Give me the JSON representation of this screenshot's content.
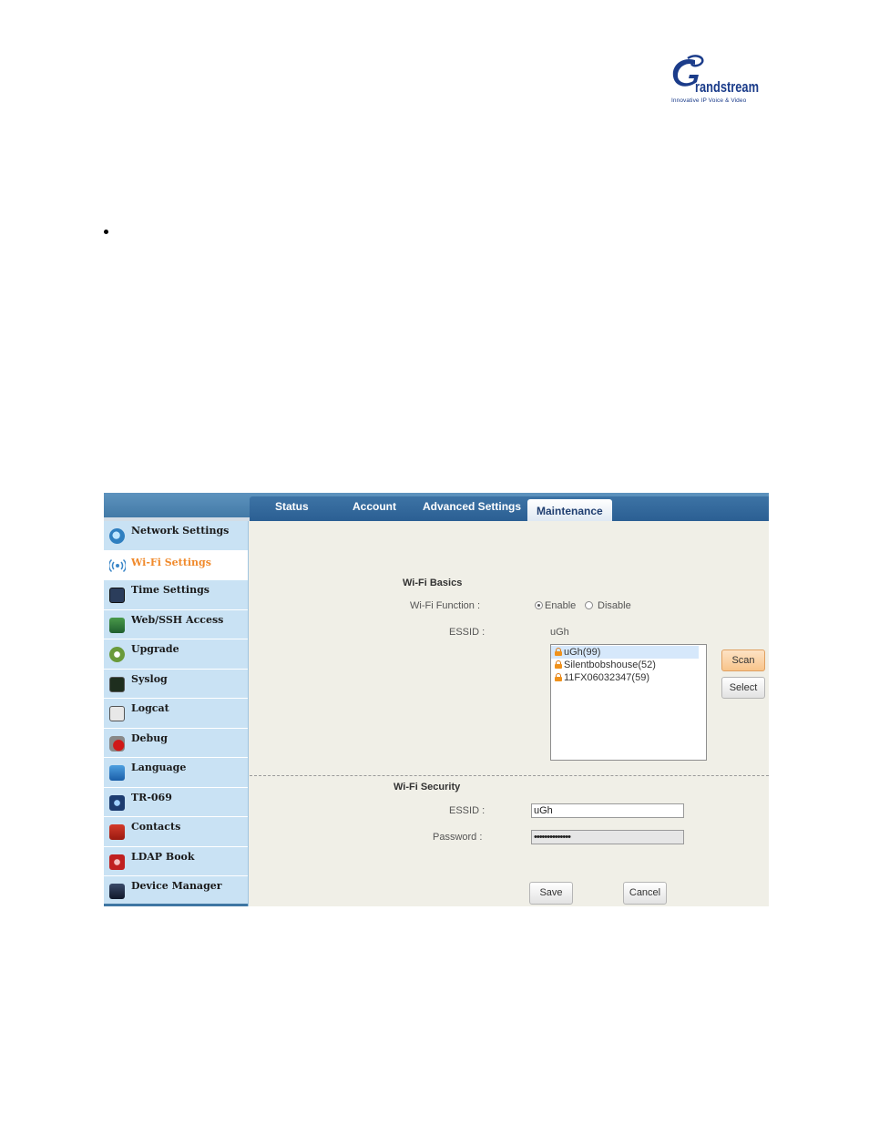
{
  "brand": {
    "logo_text": "Grandstream",
    "tagline": "Innovative IP Voice & Video"
  },
  "nav": {
    "tabs": [
      {
        "label": "Status",
        "active": false
      },
      {
        "label": "Account",
        "active": false
      },
      {
        "label": "Advanced Settings",
        "active": false
      },
      {
        "label": "Maintenance",
        "active": true
      }
    ]
  },
  "sidebar": {
    "items": [
      {
        "label": "Network Settings",
        "icon": "network-icon",
        "active": false
      },
      {
        "label": "Wi-Fi Settings",
        "icon": "wifi-icon",
        "active": true
      },
      {
        "label": "Time Settings",
        "icon": "clock-icon",
        "active": false
      },
      {
        "label": "Web/SSH Access",
        "icon": "computer-icon",
        "active": false
      },
      {
        "label": "Upgrade",
        "icon": "upgrade-icon",
        "active": false
      },
      {
        "label": "Syslog",
        "icon": "syslog-icon",
        "active": false
      },
      {
        "label": "Logcat",
        "icon": "magnifier-icon",
        "active": false
      },
      {
        "label": "Debug",
        "icon": "bug-icon",
        "active": false
      },
      {
        "label": "Language",
        "icon": "language-icon",
        "active": false
      },
      {
        "label": "TR-069",
        "icon": "camera-icon",
        "active": false
      },
      {
        "label": "Contacts",
        "icon": "phone-book-icon",
        "active": false
      },
      {
        "label": "LDAP Book",
        "icon": "ldap-icon",
        "active": false
      },
      {
        "label": "Device Manager",
        "icon": "device-manager-icon",
        "active": false
      }
    ]
  },
  "wifi_basics": {
    "heading": "Wi-Fi Basics",
    "function_label": "Wi-Fi Function :",
    "enable_label": "Enable",
    "disable_label": "Disable",
    "function_value": "Enable",
    "essid_label": "ESSID :",
    "essid_value": "uGh",
    "networks": [
      "uGh(99)",
      "Silentbobshouse(52)",
      "11FX06032347(59)"
    ],
    "selected_network": "uGh(99)",
    "scan_label": "Scan",
    "select_label": "Select"
  },
  "wifi_security": {
    "heading": "Wi-Fi Security",
    "essid_label": "ESSID :",
    "essid_value": "uGh",
    "password_label": "Password :",
    "password_value": "••••••••••••••"
  },
  "actions": {
    "save_label": "Save",
    "cancel_label": "Cancel"
  },
  "colors": {
    "accent": "#f08a2c",
    "header_blue": "#3f76a3",
    "sidebar_bg": "#c9e2f4",
    "content_bg": "#f0efe7"
  }
}
